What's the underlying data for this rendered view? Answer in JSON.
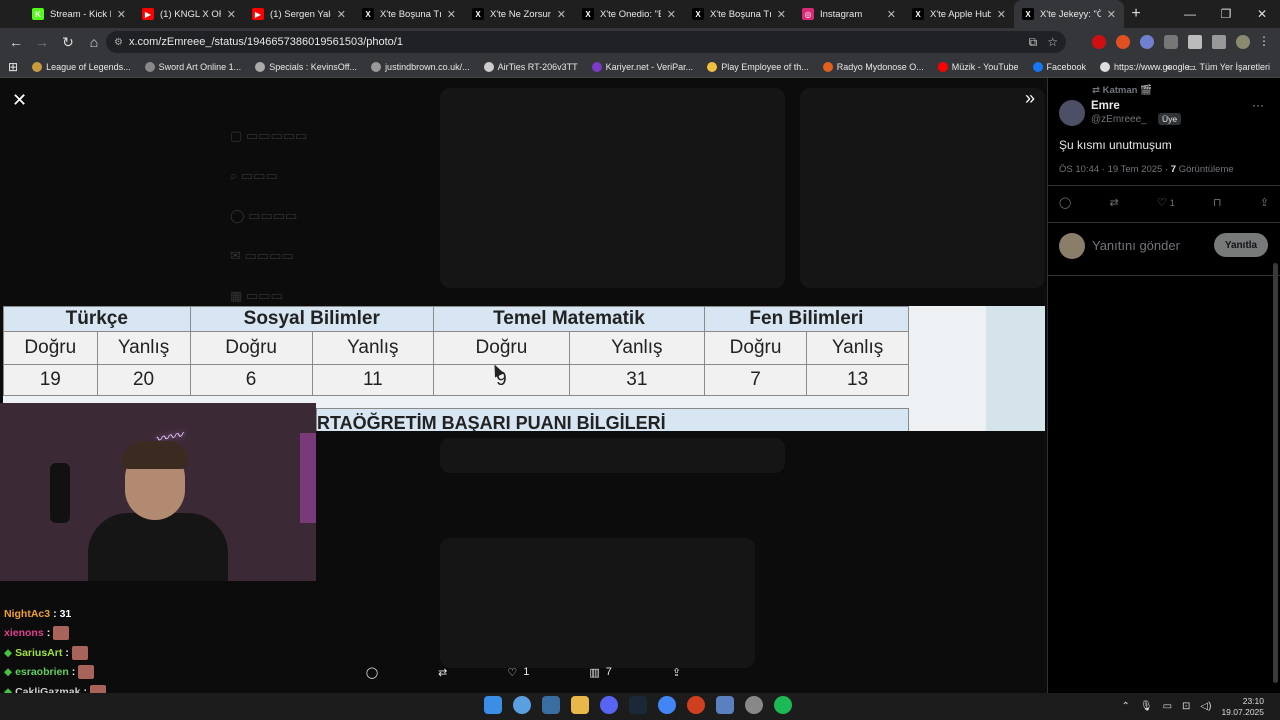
{
  "browser": {
    "tabs": [
      {
        "title": "Stream - Kick Da",
        "fav": "K",
        "color": "#53fc18"
      },
      {
        "title": "(1) KNGL X ORGA",
        "fav": "▶",
        "color": "#ff0000"
      },
      {
        "title": "(1) Sergen Yalçın",
        "fav": "▶",
        "color": "#ff0000"
      },
      {
        "title": "X'te Boşuna Tıklar",
        "fav": "X",
        "color": "#000000"
      },
      {
        "title": "X'te Ne Zorsun: \"",
        "fav": "X",
        "color": "#000000"
      },
      {
        "title": "X'te Onedio: \"Bir",
        "fav": "X",
        "color": "#000000"
      },
      {
        "title": "X'te Boşuna Tıklar",
        "fav": "X",
        "color": "#000000"
      },
      {
        "title": "Instagram",
        "fav": "◎",
        "color": "#d62976"
      },
      {
        "title": "X'te Apple Hub: \"",
        "fav": "X",
        "color": "#000000"
      },
      {
        "title": "X'te Jekeyy: \"Önc",
        "fav": "X",
        "color": "#000000"
      }
    ],
    "url": "x.com/zEmreee_/status/1946657386019561503/photo/1",
    "bookmarks": [
      {
        "label": "League of Legends...",
        "color": "#c89b3c"
      },
      {
        "label": "Sword Art Online 1...",
        "color": "#888888"
      },
      {
        "label": "Specials : KevinsOff...",
        "color": "#aaaaaa"
      },
      {
        "label": "justindbrown.co.uk/...",
        "color": "#999999"
      },
      {
        "label": "AirTies RT-206v3TT",
        "color": "#cccccc"
      },
      {
        "label": "Kariyer.net - VeriPar...",
        "color": "#7a3cc8"
      },
      {
        "label": "Play Employee of th...",
        "color": "#f0c040"
      },
      {
        "label": "Radyo Mydonose O...",
        "color": "#e06020"
      },
      {
        "label": "Müzik - YouTube",
        "color": "#ff0000"
      },
      {
        "label": "Facebook",
        "color": "#1877f2"
      },
      {
        "label": "https://www.google...",
        "color": "#dddddd"
      }
    ],
    "bookmarks_all": "Tüm Yer İşaretleri"
  },
  "photo": {
    "subjects": [
      "Türkçe",
      "Sosyal Bilimler",
      "Temel Matematik",
      "Fen Bilimleri"
    ],
    "column_labels": [
      "Doğru",
      "Yanlış",
      "Doğru",
      "Yanlış",
      "Doğru",
      "Yanlış",
      "Doğru",
      "Yanlış"
    ],
    "values": [
      "19",
      "20",
      "6",
      "11",
      "9",
      "31",
      "7",
      "13"
    ],
    "subtitle": "RTAÖĞRETİM BAŞARI PUANI BİLGİLERİ"
  },
  "viewer_actions": {
    "likes": "1",
    "views": "7"
  },
  "chat": [
    {
      "user": "NightAc3",
      "msg": "31",
      "color": "#f0a030",
      "emote": false
    },
    {
      "user": "xienons",
      "msg": "",
      "color": "#e04090",
      "emote": true
    },
    {
      "user": "SariusArt",
      "msg": "",
      "color": "#a0e040",
      "emote": true
    },
    {
      "user": "esraobrien",
      "msg": "",
      "color": "#60d060",
      "emote": true
    },
    {
      "user": "CakliGazmak",
      "msg": "",
      "color": "#d0d0d0",
      "emote": true
    }
  ],
  "tweet": {
    "reposted_by": "Katman 🎬",
    "name": "Emre",
    "handle": "@zEmreee_",
    "badge": "Üye",
    "text": "Şu kısmı unutmuşum",
    "time": "ÖS 10:44 · 19 Tem 2025 ·",
    "views_count": "7",
    "views_label": "Görüntüleme",
    "likes": "1",
    "reply_placeholder": "Yanıtını gönder",
    "reply_button": "Yanıtla"
  },
  "taskbar": {
    "time": "23:10",
    "date": "19.07.2025"
  }
}
